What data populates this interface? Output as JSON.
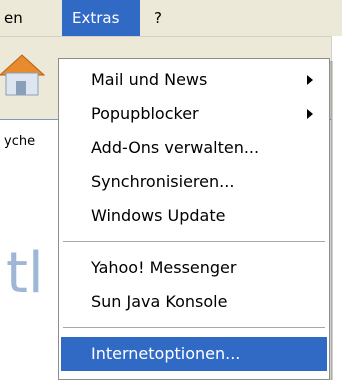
{
  "menubar": {
    "partial_left": "en",
    "extras": "Extras",
    "help": "?"
  },
  "address": {
    "partial_text": "yche"
  },
  "content": {
    "partial_text": "tl"
  },
  "dropdown": {
    "items": [
      {
        "label": "Mail und News",
        "has_submenu": true
      },
      {
        "label": "Popupblocker",
        "has_submenu": true
      },
      {
        "label": "Add-Ons verwalten...",
        "has_submenu": false
      },
      {
        "label": "Synchronisieren...",
        "has_submenu": false
      },
      {
        "label": "Windows Update",
        "has_submenu": false
      },
      {
        "label": "Yahoo! Messenger",
        "has_submenu": false
      },
      {
        "label": "Sun Java Konsole",
        "has_submenu": false
      },
      {
        "label": "Internetoptionen...",
        "has_submenu": false,
        "highlighted": true
      }
    ]
  },
  "colors": {
    "highlight": "#316ac5",
    "menubar": "#ece9d8"
  }
}
